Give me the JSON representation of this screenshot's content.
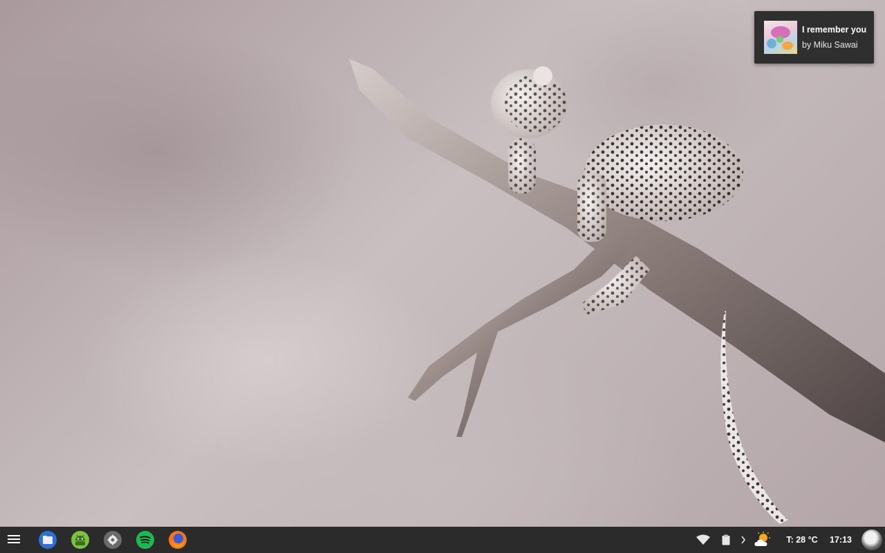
{
  "notification": {
    "title": "I remember you",
    "artist": "by Miku Sawai"
  },
  "taskbar": {
    "launcher_icon": "menu-icon",
    "apps": [
      {
        "name": "files-app",
        "icon": "files-icon",
        "color": "#2f6fd6"
      },
      {
        "name": "android-app",
        "icon": "android-icon",
        "color": "#7cc142"
      },
      {
        "name": "settings-app",
        "icon": "gear-icon",
        "color": "#6b6b6b"
      },
      {
        "name": "spotify-app",
        "icon": "spotify-icon",
        "color": "#1db954"
      },
      {
        "name": "firefox-app",
        "icon": "firefox-icon",
        "color": "#f1761e"
      }
    ],
    "tray": {
      "wifi_icon": "wifi-icon",
      "clipboard_icon": "clipboard-icon",
      "expand_icon": "chevron-right-icon",
      "weather_icon": "partly-cloudy-icon",
      "temperature": "T: 28 °C",
      "time": "17:13",
      "avatar_icon": "user-avatar"
    }
  }
}
